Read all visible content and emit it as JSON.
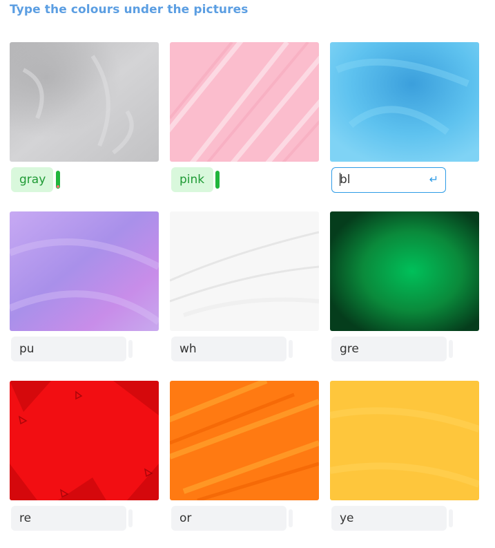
{
  "title": "Type the colours under the pictures",
  "enter_icon": "enter-key-icon",
  "tiles": [
    {
      "color": "#c9c9cb",
      "answer": "gray",
      "state": "correct"
    },
    {
      "color": "#fbbfcf",
      "answer": "pink",
      "state": "correct"
    },
    {
      "color": "#5cbfec",
      "answer": "bl",
      "state": "active"
    },
    {
      "color": "#b796ee",
      "answer": "pu",
      "state": "empty"
    },
    {
      "color": "#f6f6f6",
      "answer": "wh",
      "state": "empty"
    },
    {
      "color": "#0b8a3c",
      "answer": "gre",
      "state": "empty"
    },
    {
      "color": "#f20e12",
      "answer": "re",
      "state": "empty"
    },
    {
      "color": "#ff7a12",
      "answer": "or",
      "state": "empty"
    },
    {
      "color": "#fec63c",
      "answer": "ye",
      "state": "empty"
    }
  ]
}
